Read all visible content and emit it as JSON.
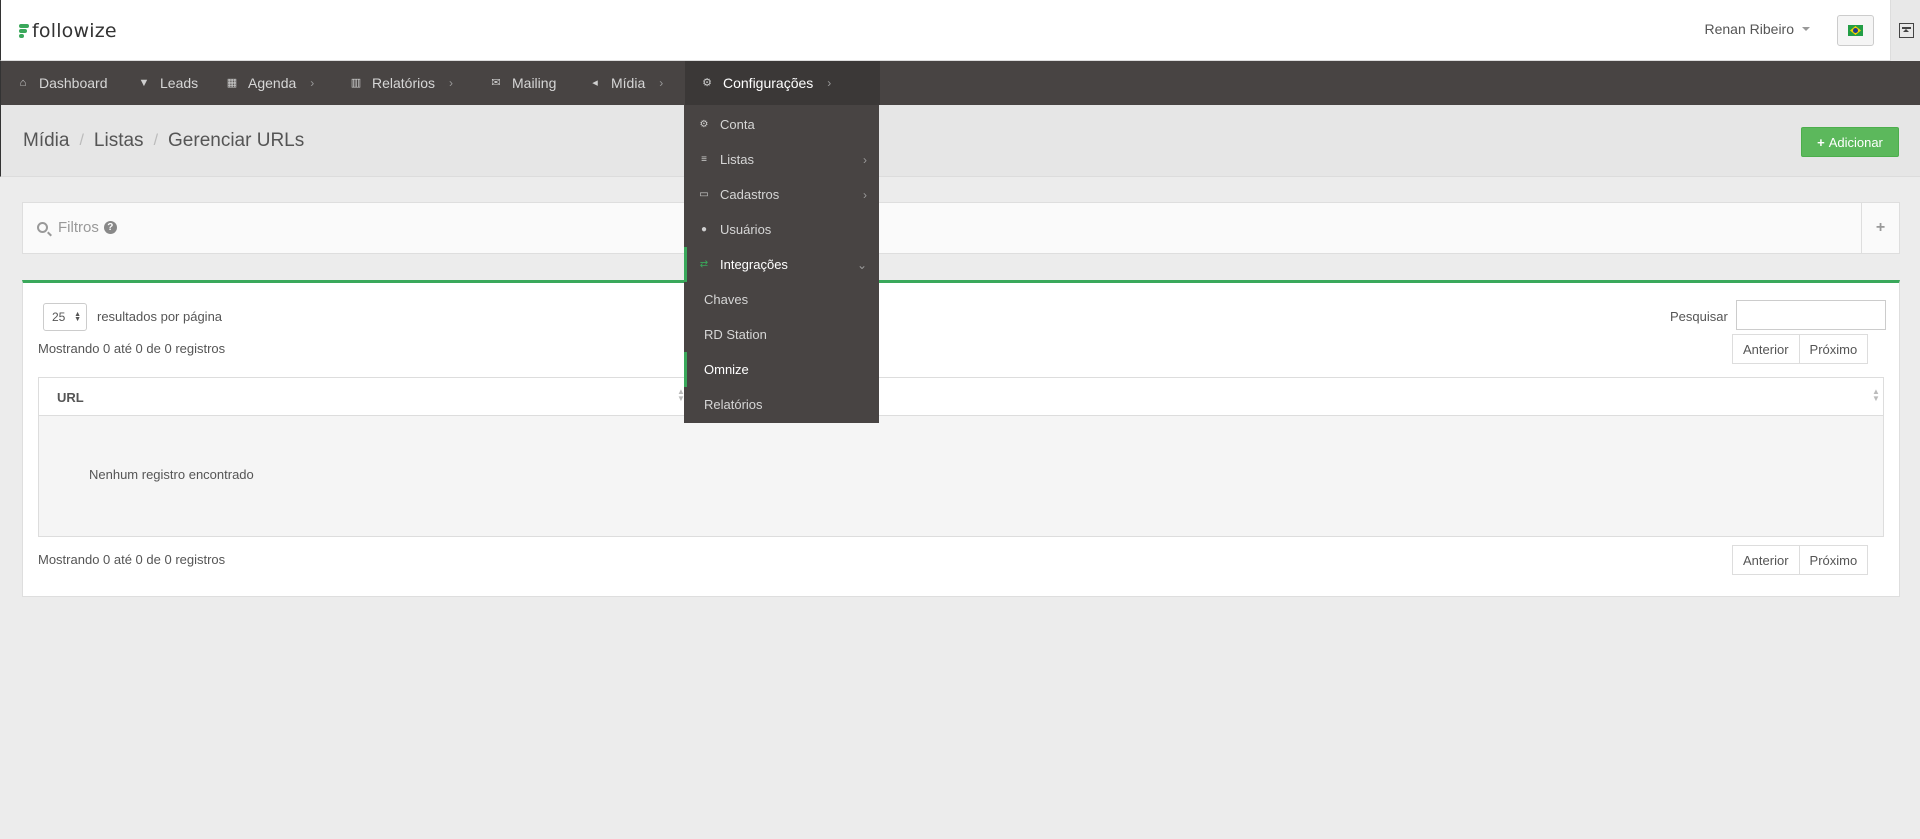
{
  "brand": {
    "name": "followize",
    "accent": "#3aa85b"
  },
  "header": {
    "user_name": "Renan Ribeiro",
    "flag_icon": "brazil-flag-icon"
  },
  "nav": {
    "items": [
      {
        "label": "Dashboard",
        "icon": "home-icon"
      },
      {
        "label": "Leads",
        "icon": "funnel-icon"
      },
      {
        "label": "Agenda",
        "icon": "calendar-icon"
      },
      {
        "label": "Relatórios",
        "icon": "bar-chart-icon"
      },
      {
        "label": "Mailing",
        "icon": "envelope-icon"
      },
      {
        "label": "Mídia",
        "icon": "megaphone-icon"
      },
      {
        "label": "Configurações",
        "icon": "gears-icon"
      }
    ]
  },
  "config_menu": {
    "items": [
      {
        "label": "Conta",
        "icon": "gear-icon"
      },
      {
        "label": "Listas",
        "icon": "list-icon"
      },
      {
        "label": "Cadastros",
        "icon": "folder-open-icon"
      },
      {
        "label": "Usuários",
        "icon": "users-icon"
      },
      {
        "label": "Integrações",
        "icon": "exchange-icon"
      }
    ],
    "integrations_sub": [
      {
        "label": "Chaves"
      },
      {
        "label": "RD Station"
      },
      {
        "label": "Omnize"
      },
      {
        "label": "Relatórios"
      }
    ]
  },
  "breadcrumb": {
    "items": [
      "Mídia",
      "Listas",
      "Gerenciar URLs"
    ]
  },
  "actions": {
    "add_label": "Adicionar"
  },
  "filters": {
    "label": "Filtros"
  },
  "table": {
    "page_length": "25",
    "page_length_label": "resultados por página",
    "search_label": "Pesquisar",
    "search_value": "",
    "info_top": "Mostrando 0 até 0 de 0 registros",
    "info_bottom": "Mostrando 0 até 0 de 0 registros",
    "prev_label": "Anterior",
    "next_label": "Próximo",
    "columns": [
      "URL",
      ""
    ],
    "empty_message": "Nenhum registro encontrado"
  }
}
